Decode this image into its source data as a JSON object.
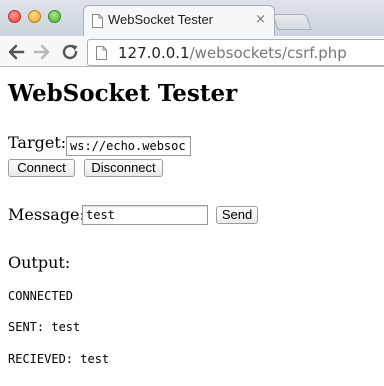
{
  "browser": {
    "tab_title": "WebSocket Tester",
    "tab_close_glyph": "×",
    "url_host": "127.0.0.1",
    "url_path": "/websockets/csrf.php"
  },
  "page": {
    "heading": "WebSocket Tester",
    "target_label": "Target:",
    "target_value": "ws://echo.websocket.org",
    "connect_label": "Connect",
    "disconnect_label": "Disconnect",
    "message_label": "Message:",
    "message_value": "test",
    "send_label": "Send",
    "output_label": "Output:",
    "output_lines": [
      "CONNECTED",
      "SENT: test",
      "RECIEVED: test"
    ]
  },
  "icons": {
    "back": "arrow-left-icon",
    "forward": "arrow-right-icon",
    "reload": "reload-icon",
    "page": "document-icon"
  },
  "colors": {
    "close": "#e5423a",
    "minimize": "#e6a42a",
    "maximize": "#4fae33"
  }
}
